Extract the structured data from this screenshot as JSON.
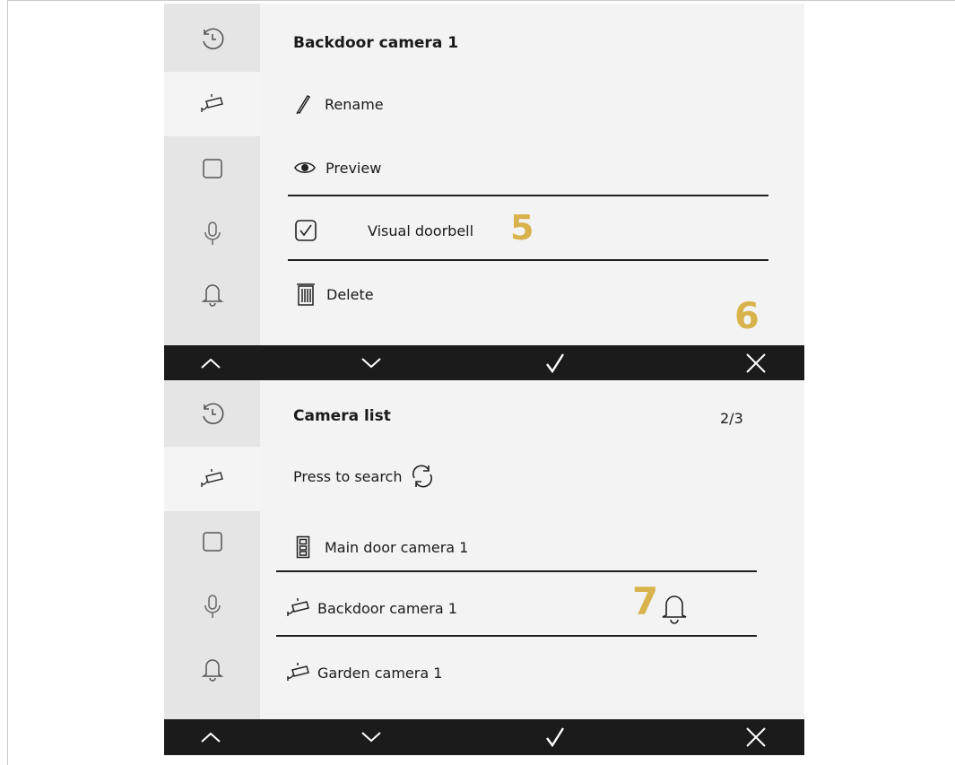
{
  "colors": {
    "callout": "#d8b24a",
    "bar": "#1b1b1b",
    "sidebar": "#e5e5e5",
    "content": "#f3f3f3"
  },
  "sidebar_icons": [
    "history-icon",
    "camera-icon",
    "square-icon",
    "microphone-icon",
    "bell-icon"
  ],
  "bottom_bar_icons": [
    "chevron-up-icon",
    "chevron-down-icon",
    "check-icon",
    "close-icon"
  ],
  "screen1": {
    "title": "Backdoor camera 1",
    "rename": "Rename",
    "preview": "Preview",
    "visual_doorbell": "Visual doorbell",
    "visual_doorbell_checked": true,
    "delete": "Delete",
    "callout_5": "5",
    "callout_6": "6"
  },
  "screen2": {
    "title": "Camera list",
    "page_counter": "2/3",
    "search": "Press to search",
    "cameras": [
      "Main door camera 1",
      "Backdoor camera 1",
      "Garden camera 1"
    ],
    "callout_7": "7"
  }
}
